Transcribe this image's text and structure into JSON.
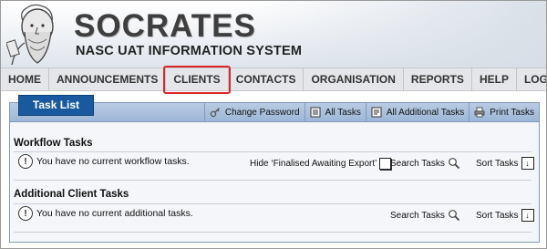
{
  "header": {
    "brand": "SOCRATES",
    "subtitle": "NASC UAT INFORMATION SYSTEM",
    "logo": "socrates-bust-icon"
  },
  "nav": {
    "items": [
      "HOME",
      "ANNOUNCEMENTS",
      "CLIENTS",
      "CONTACTS",
      "ORGANISATION",
      "REPORTS",
      "HELP",
      "LOG OFF"
    ],
    "highlighted": "CLIENTS",
    "highlight_color": "#d9262b"
  },
  "panel": {
    "tab_label": "Task List",
    "toolbar": {
      "change_password": "Change Password",
      "all_tasks": "All Tasks",
      "all_additional_tasks": "All Additional Tasks",
      "print_tasks": "Print Tasks"
    }
  },
  "workflow": {
    "title": "Workflow Tasks",
    "message": "You have no current workflow tasks.",
    "hide_label": "Hide ‘Finalised Awaiting Export’",
    "search_label": "Search Tasks",
    "sort_label": "Sort Tasks"
  },
  "additional": {
    "title": "Additional Client Tasks",
    "message": "You have no current additional tasks.",
    "search_label": "Search Tasks",
    "sort_label": "Sort Tasks"
  },
  "colors": {
    "accent": "#195a9e",
    "panel_bar": "#a9bfdd"
  }
}
